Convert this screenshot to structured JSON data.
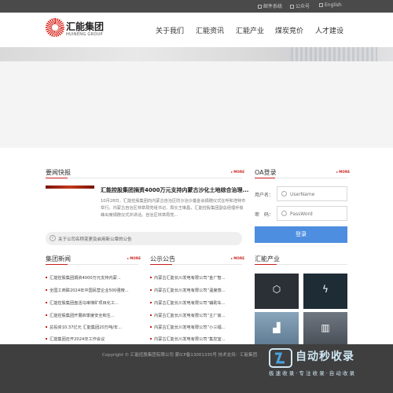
{
  "topbar": {
    "mail": "邮件系统",
    "wechat": "公众号",
    "english": "English"
  },
  "brand": {
    "name_cn": "汇能集团",
    "name_en": "HUINENG GROUP",
    "logo_icon": "huineng-logo-icon"
  },
  "nav": [
    "关于我们",
    "汇能资讯",
    "汇能产业",
    "煤炭竞价",
    "人才建设"
  ],
  "news_express": {
    "title": "要闻快报",
    "more": "MORE",
    "feature_title": "汇能控股集团捐资4000万元支持内蒙古沙化土地综合治理...",
    "feature_summary": "10月28日，汇能控股集团向内蒙古自治区防沙治沙基金会捐赠仪式在呼和浩特市举行。内蒙古自治区林草局党组书记、局长王琳昌，汇能控股集团副总经理乔俊峰出席捐赠仪式并讲话。自治区林草局党...",
    "notice": "关于公司名称变更及启用新公章的公告"
  },
  "login": {
    "title": "OA登录",
    "more": "MORE",
    "user_label": "用户名：",
    "user_placeholder": "UserName",
    "pass_label": "密　码：",
    "pass_placeholder": "PassWord",
    "button": "登录"
  },
  "group_news": {
    "title": "集团新闻",
    "more": "MORE",
    "items": [
      "汇能控股集团捐资4000万元支持内蒙...",
      "全国工商联2024年中国民营企业500强榜...",
      "汇能控股集团盘活乌审煤矿项目化工...",
      "汇能控股集团开展四季度安全和生...",
      "总投资10.37亿元 汇能集团20万吨/年...",
      "汇能集团召开2024年工作会议"
    ]
  },
  "announcements": {
    "title": "公示公告",
    "more": "MORE",
    "items": [
      "内蒙古汇能长川发电有限公司“金厂智...",
      "内蒙古汇能长川发电有限公司“温度感...",
      "内蒙古汇能长川发电有限公司“辅助车...",
      "内蒙古汇能长川发电有限公司“主厂房...",
      "内蒙古汇能长川发电有限公司“小三幅...",
      "内蒙古汇能长川发电有限公司“集控室..."
    ]
  },
  "industry": {
    "title": "汇能产业",
    "tiles": [
      {
        "icon": "hexagon-icon",
        "color": "#2b2f36"
      },
      {
        "icon": "lightning-icon",
        "color": "#1e2c36"
      },
      {
        "icon": "factory-icon",
        "color": "#6f8fa8"
      },
      {
        "icon": "plant-icon",
        "color": "#5b6470"
      }
    ]
  },
  "footer": {
    "text": "Copyright © 汇能控股集团有限公司  蒙ICP备13001335号  技术支持：汇能集团"
  },
  "watermark": {
    "title": "自动秒收录",
    "subtitle": "极 速 收 录 · 专 注 收 录 · 自 动 收 录"
  }
}
